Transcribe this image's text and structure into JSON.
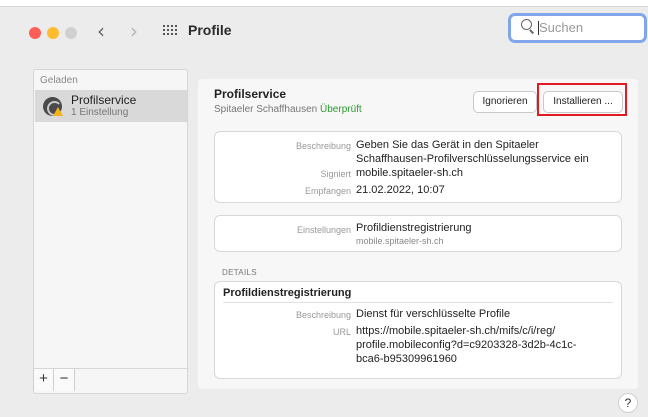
{
  "window": {
    "title": "Profile",
    "search": {
      "placeholder": "Suchen"
    }
  },
  "sidebar": {
    "section_label": "Geladen",
    "items": [
      {
        "name": "Profilservice",
        "subtitle": "1 Einstellung"
      }
    ],
    "add_label": "+",
    "remove_label": "−"
  },
  "profile": {
    "name": "Profilservice",
    "organization": "Spitaeler Schaffhausen",
    "verified": "Überprüft",
    "ignore_label": "Ignorieren",
    "install_label": "Installieren ...",
    "info": {
      "description_label": "Beschreibung",
      "description_line1": "Geben Sie das Gerät in den Spitaeler",
      "description_line2": "Schaffhausen-Profilverschlüsselungsservice ein",
      "signed_label": "Signiert",
      "signed_value": "mobile.spitaeler-sh.ch",
      "received_label": "Empfangen",
      "received_value": "21.02.2022, 10:07"
    },
    "settings": {
      "label": "Einstellungen",
      "value": "Profildienstregistrierung",
      "sub": "mobile.spitaeler-sh.ch"
    },
    "details": {
      "heading": "DETAILS",
      "title": "Profildienstregistrierung",
      "description_label": "Beschreibung",
      "description_value": "Dienst für verschlüsselte Profile",
      "url_label": "URL",
      "url_line1": "https://mobile.spitaeler-sh.ch/mifs/c/i/reg/",
      "url_line2": "profile.mobileconfig?d=c9203328-3d2b-4c1c-",
      "url_line3": "bca6-b95309961960"
    }
  },
  "help_label": "?"
}
